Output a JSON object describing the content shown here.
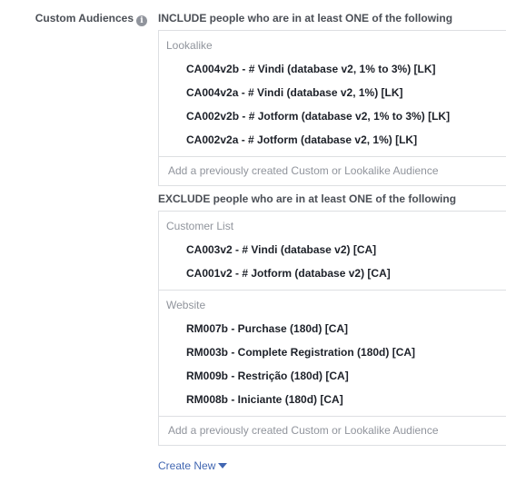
{
  "field_label": "Custom Audiences",
  "info_icon_glyph": "i",
  "include": {
    "title": "INCLUDE people who are in at least ONE of the following",
    "groups": [
      {
        "title": "Lookalike",
        "items": [
          "CA004v2b - # Vindi (database v2, 1% to 3%) [LK]",
          "CA004v2a - # Vindi (database v2, 1%) [LK]",
          "CA002v2b - # Jotform (database v2, 1% to 3%) [LK]",
          "CA002v2a - # Jotform (database v2, 1%) [LK]"
        ]
      }
    ],
    "add_placeholder": "Add a previously created Custom or Lookalike Audience"
  },
  "exclude": {
    "title": "EXCLUDE people who are in at least ONE of the following",
    "groups": [
      {
        "title": "Customer List",
        "items": [
          "CA003v2 - # Vindi (database v2) [CA]",
          "CA001v2 - # Jotform (database v2) [CA]"
        ]
      },
      {
        "title": "Website",
        "items": [
          "RM007b - Purchase (180d) [CA]",
          "RM003b - Complete Registration (180d) [CA]",
          "RM009b - Restrição (180d) [CA]",
          "RM008b - Iniciante (180d) [CA]"
        ]
      }
    ],
    "add_placeholder": "Add a previously created Custom or Lookalike Audience"
  },
  "create_new_label": "Create New",
  "colors": {
    "link": "#4267b2",
    "label": "#4b4f56",
    "muted": "#90949c",
    "border": "#dddfe2"
  }
}
